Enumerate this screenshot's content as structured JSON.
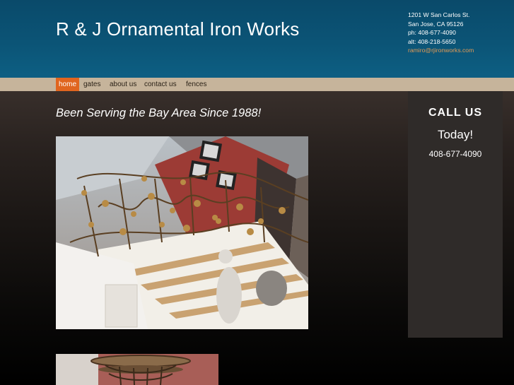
{
  "header": {
    "title": "R & J Ornamental Iron Works",
    "contact": {
      "address_line1": "1201 W San Carlos St.",
      "address_line2": "San Jose, CA 95126",
      "phone": "ph: 408-677-4090",
      "alt_phone": "alt: 408-218-5650",
      "email": "ramiro@rjironworks.com"
    }
  },
  "nav": {
    "items": [
      {
        "label": "home",
        "active": true
      },
      {
        "label": "gates",
        "active": false
      },
      {
        "label": "about us",
        "active": false
      },
      {
        "label": "contact us",
        "active": false
      },
      {
        "label": "fences",
        "active": false
      }
    ]
  },
  "main": {
    "tagline": "Been Serving the Bay Area Since 1988!"
  },
  "sidebar": {
    "heading": "CALL US",
    "subheading": "Today!",
    "phone": "408-677-4090"
  },
  "colors": {
    "header_bg": "#0b5476",
    "nav_bg": "#c6b49b",
    "nav_active": "#e0651f",
    "email_link": "#e39a55",
    "sidebar_bg": "#2f2b29"
  }
}
